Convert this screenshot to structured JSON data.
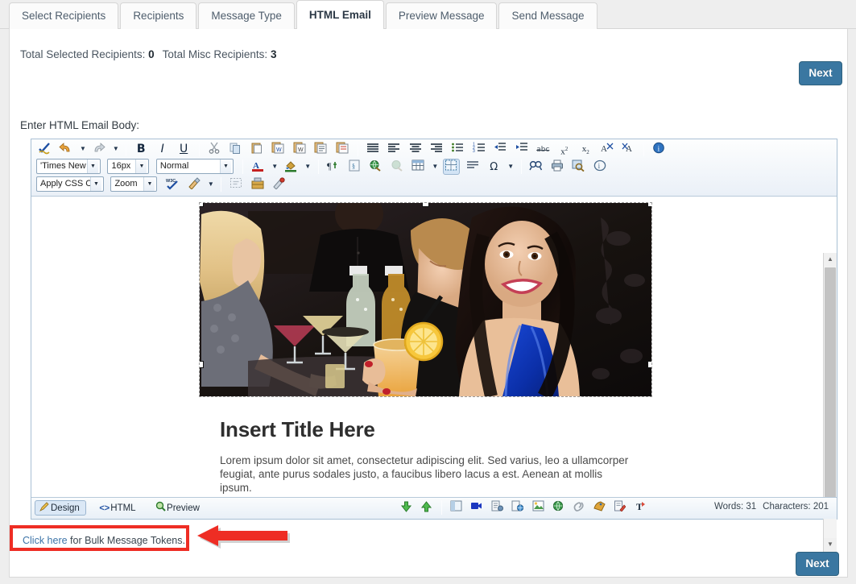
{
  "tabs": [
    {
      "label": "Select Recipients",
      "active": false
    },
    {
      "label": "Recipients",
      "active": false
    },
    {
      "label": "Message Type",
      "active": false
    },
    {
      "label": "HTML Email",
      "active": true
    },
    {
      "label": "Preview Message",
      "active": false
    },
    {
      "label": "Send Message",
      "active": false
    }
  ],
  "recipients": {
    "selected_label": "Total Selected Recipients:",
    "selected_count": "0",
    "misc_label": "Total Misc Recipients:",
    "misc_count": "3"
  },
  "buttons": {
    "next_top": "Next",
    "next_bottom": "Next"
  },
  "editor": {
    "label": "Enter HTML Email Body:",
    "toolbar_row1": [
      {
        "name": "spellcheck-icon",
        "title": "Spell Check"
      },
      {
        "name": "undo-icon",
        "title": "Undo"
      },
      {
        "name": "undo-dropdown-icon",
        "title": "Undo History"
      },
      {
        "name": "redo-icon",
        "title": "Redo"
      },
      {
        "name": "redo-dropdown-icon",
        "title": "Redo History"
      },
      {
        "name": "bold-icon",
        "title": "Bold",
        "glyph": "B"
      },
      {
        "name": "italic-icon",
        "title": "Italic",
        "glyph": "I"
      },
      {
        "name": "underline-icon",
        "title": "Underline",
        "glyph": "U"
      },
      {
        "name": "cut-icon",
        "title": "Cut"
      },
      {
        "name": "copy-icon",
        "title": "Copy"
      },
      {
        "name": "paste-icon",
        "title": "Paste"
      },
      {
        "name": "paste-from-word-icon",
        "title": "Paste from Word"
      },
      {
        "name": "paste-from-word-strip-icon",
        "title": "Paste from Word, strip font"
      },
      {
        "name": "paste-plain-text-icon",
        "title": "Paste Plain Text"
      },
      {
        "name": "paste-as-html-icon",
        "title": "Paste As HTML"
      },
      {
        "name": "align-justify-icon",
        "title": "Justify"
      },
      {
        "name": "align-left-icon",
        "title": "Align Left"
      },
      {
        "name": "align-center-icon",
        "title": "Align Center"
      },
      {
        "name": "align-right-icon",
        "title": "Align Right"
      },
      {
        "name": "bullet-list-icon",
        "title": "Bulleted List"
      },
      {
        "name": "numbered-list-icon",
        "title": "Numbered List"
      },
      {
        "name": "outdent-icon",
        "title": "Outdent"
      },
      {
        "name": "indent-icon",
        "title": "Indent"
      },
      {
        "name": "strikethrough-icon",
        "title": "Strikethrough",
        "glyph": "abc"
      },
      {
        "name": "superscript-icon",
        "title": "Superscript"
      },
      {
        "name": "subscript-icon",
        "title": "Subscript"
      },
      {
        "name": "format-stripper-icon",
        "title": "Strip Formatting"
      },
      {
        "name": "format-code-block-icon",
        "title": "Format Code Block"
      },
      {
        "name": "about-icon",
        "title": "About"
      }
    ],
    "font_family": "'Times New ...",
    "font_size": "16px",
    "paragraph_style": "Normal",
    "toolbar_row2": [
      {
        "name": "foreground-color-icon",
        "title": "Foreground Color",
        "glyph": "A"
      },
      {
        "name": "foreground-color-dropdown-icon",
        "title": "Foreground Color Options"
      },
      {
        "name": "background-color-icon",
        "title": "Background Color"
      },
      {
        "name": "background-color-dropdown-icon",
        "title": "Background Color Options"
      },
      {
        "name": "format-block-icon",
        "title": "Format Block"
      },
      {
        "name": "module-manager-icon",
        "title": "Module Manager"
      },
      {
        "name": "insert-symbol-icon",
        "title": "Insert Symbol"
      },
      {
        "name": "hyperlink-manager-icon",
        "title": "Hyperlink Manager"
      },
      {
        "name": "remove-link-icon",
        "title": "Remove Link"
      },
      {
        "name": "insert-table-icon",
        "title": "Insert Table"
      },
      {
        "name": "insert-table-dropdown-icon",
        "title": "Table Options"
      },
      {
        "name": "toggle-table-border-icon",
        "title": "Toggle Table Border"
      },
      {
        "name": "horizontal-rule-icon",
        "title": "Insert Horizontal Rule"
      },
      {
        "name": "omega-symbol-icon",
        "title": "Insert Symbol",
        "glyph": "Ω"
      },
      {
        "name": "omega-dropdown-icon",
        "title": "Symbol Options"
      },
      {
        "name": "find-replace-icon",
        "title": "Find and Replace"
      },
      {
        "name": "print-icon",
        "title": "Print"
      },
      {
        "name": "zoom-preview-icon",
        "title": "Preview"
      },
      {
        "name": "help-icon",
        "title": "Help"
      }
    ],
    "css_class_label": "Apply CSS Cl...",
    "zoom_label": "Zoom",
    "toolbar_row3": [
      {
        "name": "w3c-validator-icon",
        "title": "W3C Validate"
      },
      {
        "name": "format-painter-icon",
        "title": "Format Painter"
      },
      {
        "name": "format-painter-dropdown-icon",
        "title": "Format Painter Options"
      },
      {
        "name": "show-blocks-icon",
        "title": "Show Blocks"
      },
      {
        "name": "template-manager-icon",
        "title": "Template Manager"
      },
      {
        "name": "css-class-inspector-icon",
        "title": "CSS Inspector"
      }
    ],
    "status_modes": [
      {
        "name": "design-mode",
        "label": "Design",
        "active": true
      },
      {
        "name": "html-mode",
        "label": "HTML",
        "active": false
      },
      {
        "name": "preview-mode",
        "label": "Preview",
        "active": false
      }
    ],
    "status_tools": [
      {
        "name": "insert-below-icon",
        "title": "Insert Paragraph Below"
      },
      {
        "name": "insert-above-icon",
        "title": "Insert Paragraph Above"
      },
      {
        "name": "insert-form-icon",
        "title": "Insert Form Element"
      },
      {
        "name": "insert-video-icon",
        "title": "Insert Video"
      },
      {
        "name": "insert-document-icon",
        "title": "Document Manager"
      },
      {
        "name": "insert-flash-icon",
        "title": "Flash Manager"
      },
      {
        "name": "insert-image-icon",
        "title": "Image Manager"
      },
      {
        "name": "insert-media-icon",
        "title": "Media Manager"
      },
      {
        "name": "attach-link-icon",
        "title": "Link Manager"
      },
      {
        "name": "image-editor-icon",
        "title": "Image Editor"
      },
      {
        "name": "edit-document-icon",
        "title": "Edit Document"
      },
      {
        "name": "track-changes-icon",
        "title": "Track Changes"
      }
    ],
    "words_label": "Words:",
    "words_count": "31",
    "characters_label": "Characters:",
    "characters_count": "201"
  },
  "document": {
    "image_alt": "photo-friends-at-bar-with-drinks",
    "title": "Insert Title Here",
    "paragraph_line1": "Lorem ipsum dolor sit amet, consectetur adipiscing elit. Sed varius, leo a ullamcorper",
    "paragraph_line2": "feugiat, ante purus sodales justo, a faucibus libero lacus a est. Aenean at mollis ipsum."
  },
  "tokens": {
    "link_text": "Click here",
    "rest_text": " for Bulk Message Tokens."
  },
  "colors": {
    "accent_blue": "#3a77a1",
    "annotation_red": "#ee2d24",
    "tab_bar_bg": "#eeeeee",
    "toolbar_bg": "#eaf0f7",
    "link_blue": "#3d74a8"
  }
}
